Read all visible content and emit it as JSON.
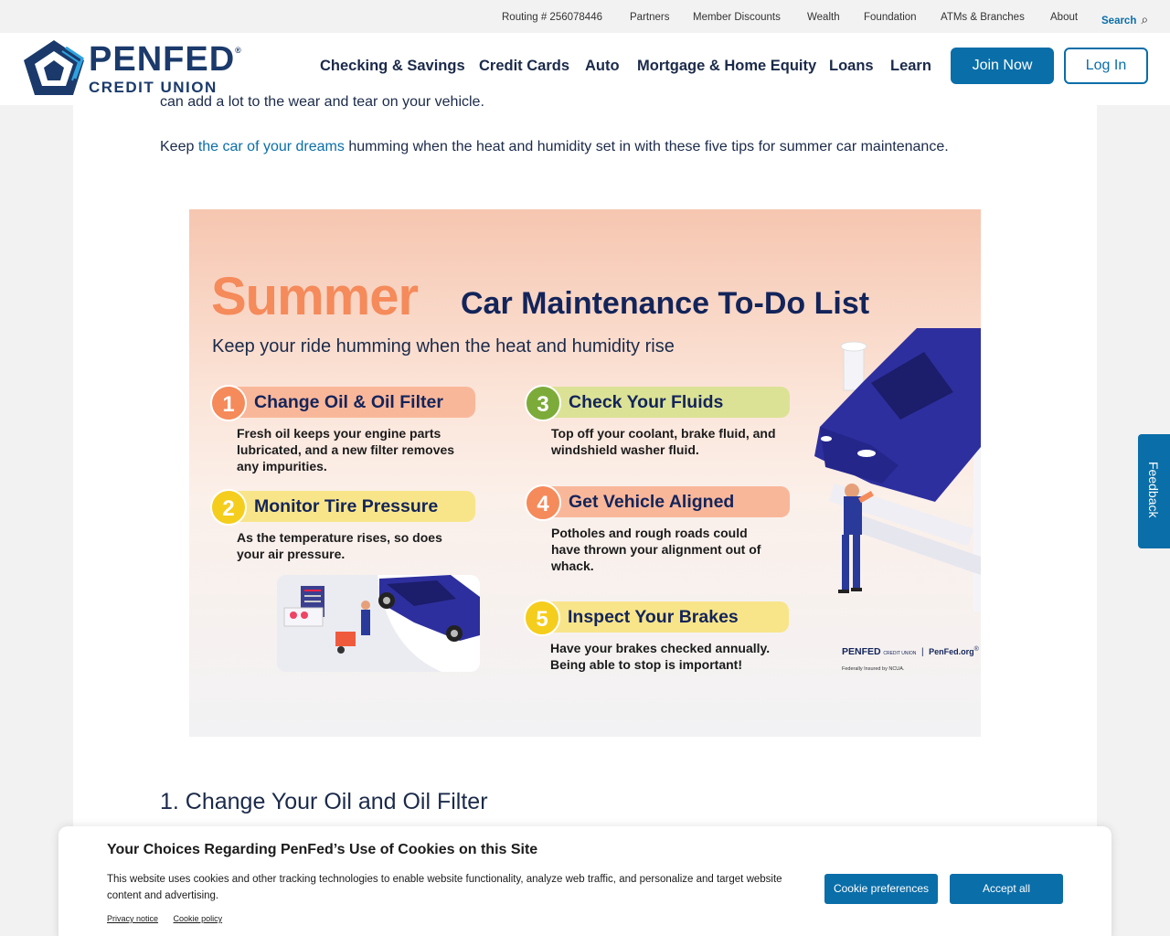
{
  "utility": {
    "routing": "Routing # 256078446",
    "partners": "Partners",
    "discounts": "Member Discounts",
    "wealth": "Wealth",
    "foundation": "Foundation",
    "atms": "ATMs & Branches",
    "about": "About",
    "search": "Search"
  },
  "logo": {
    "line1": "PENFED",
    "reg": "®",
    "line2": "CREDIT UNION"
  },
  "nav": {
    "checking": "Checking & Savings",
    "cards": "Credit Cards",
    "auto": "Auto",
    "mortgage": "Mortgage & Home Equity",
    "loans": "Loans",
    "learn": "Learn",
    "join": "Join Now",
    "login": "Log In"
  },
  "article": {
    "cut_text": "can add a lot to the wear and tear on your vehicle.",
    "intro_pre": "Keep ",
    "intro_link": "the car of your dreams",
    "intro_post": " humming when the heat and humidity set in with these five tips for summer car maintenance.",
    "heading": "1. Change Your Oil and Oil Filter"
  },
  "infographic": {
    "title_accent": "Summer",
    "title": "Car Maintenance To-Do List",
    "subtitle": "Keep your ride humming when the heat and humidity rise",
    "steps": [
      {
        "num": "1",
        "title": "Change Oil & Oil Filter",
        "body": "Fresh oil keeps your engine parts lubricated, and a new filter removes any impurities."
      },
      {
        "num": "2",
        "title": "Monitor Tire Pressure",
        "body": "As the temperature rises, so does your air pressure."
      },
      {
        "num": "3",
        "title": "Check Your Fluids",
        "body": "Top off your coolant, brake fluid, and windshield washer fluid."
      },
      {
        "num": "4",
        "title": "Get Vehicle Aligned",
        "body": "Potholes and rough roads could have thrown your alignment out of whack."
      },
      {
        "num": "5",
        "title": "Inspect Your Brakes",
        "body": "Have your brakes checked annually. Being able to stop is important!"
      }
    ],
    "mini_logo": "PENFED",
    "mini_logo_sub": "CREDIT UNION",
    "mini_site": "PenFed.org",
    "mini_reg": "®",
    "mini_insured": "Federally Insured by NCUA."
  },
  "colors": {
    "accent": "#0a6ea8",
    "orange": "#f58a5b",
    "navy": "#13245a",
    "green": "#7cab3a",
    "yellow": "#f5cd1d"
  },
  "feedback": "Feedback",
  "cookie": {
    "title": "Your Choices Regarding PenFed’s Use of Cookies on this Site",
    "body": "This website uses cookies and other tracking technologies to enable website functionality, analyze web traffic, and personalize and target website content and advertising.",
    "privacy": "Privacy notice",
    "policy": "Cookie policy",
    "prefs": "Cookie preferences",
    "accept": "Accept all"
  }
}
